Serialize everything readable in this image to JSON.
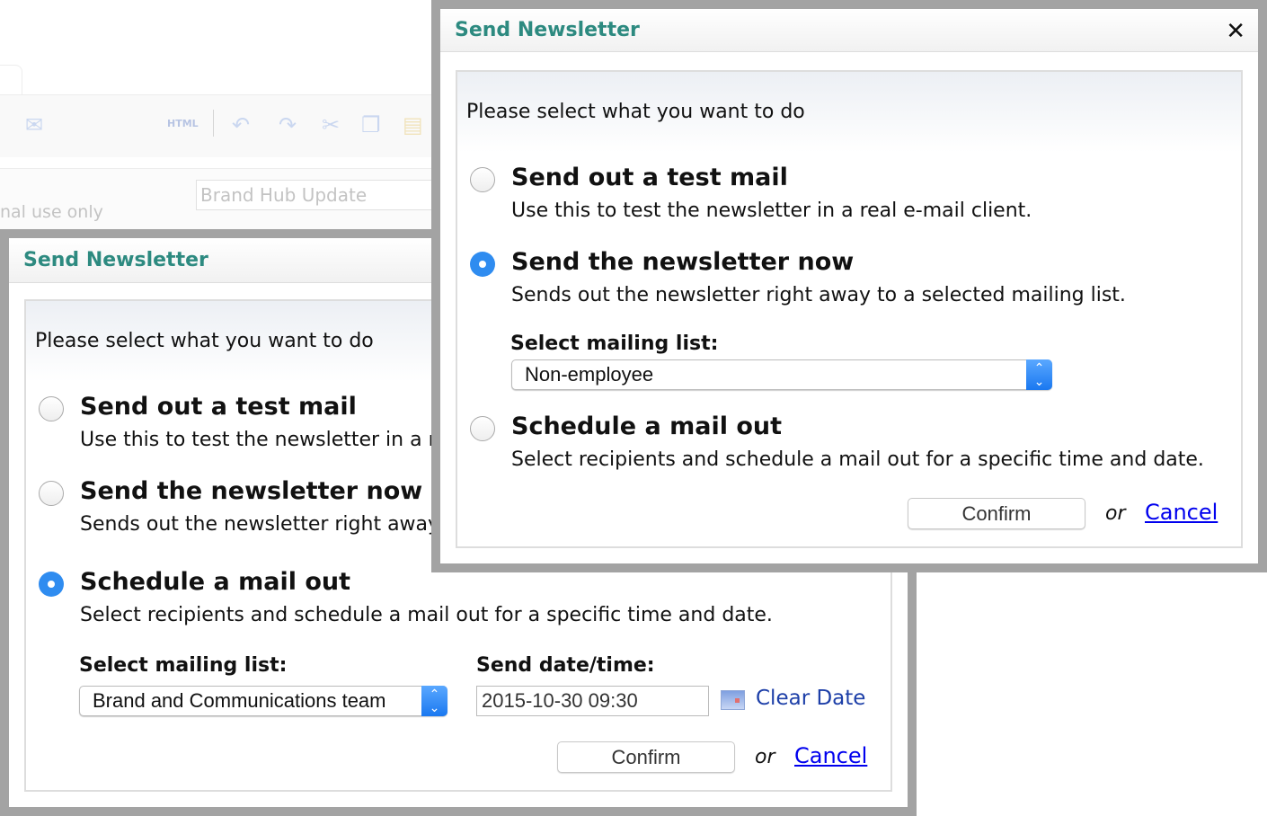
{
  "background": {
    "toolbar_html_label": "HTML",
    "note": "nal use only",
    "subject_value": "Brand Hub Update"
  },
  "dialog_back": {
    "title": "Send Newsletter",
    "prompt": "Please select what you want to do",
    "options": [
      {
        "title": "Send out a test mail",
        "desc": "Use this to test the newsletter in a r",
        "selected": false
      },
      {
        "title": "Send the newsletter now",
        "desc": "Sends out the newsletter right away",
        "selected": false
      },
      {
        "title": "Schedule a mail out",
        "desc": "Select recipients and schedule a mail out for a specific time and date.",
        "selected": true
      }
    ],
    "mailing_list_label": "Select mailing list:",
    "mailing_list_value": "Brand and Communications team",
    "date_label": "Send date/time:",
    "date_value": "2015-10-30 09:30",
    "clear_date": "Clear Date",
    "confirm": "Confirm",
    "or": "or",
    "cancel": "Cancel"
  },
  "dialog_front": {
    "title": "Send Newsletter",
    "close": "✕",
    "prompt": "Please select what you want to do",
    "options": [
      {
        "title": "Send out a test mail",
        "desc": "Use this to test the newsletter in a real e-mail client.",
        "selected": false
      },
      {
        "title": "Send the newsletter now",
        "desc": "Sends out the newsletter right away to a selected mailing list.",
        "selected": true
      },
      {
        "title": "Schedule a mail out",
        "desc": "Select recipients and schedule a mail out for a specific time and date.",
        "selected": false
      }
    ],
    "mailing_list_label": "Select mailing list:",
    "mailing_list_value": "Non-employee",
    "confirm": "Confirm",
    "or": "or",
    "cancel": "Cancel"
  },
  "colors": {
    "title": "#2d8a80",
    "radio_selected": "#2f8cf0",
    "link": "#0000ee",
    "frame": "#a3a3a3"
  }
}
